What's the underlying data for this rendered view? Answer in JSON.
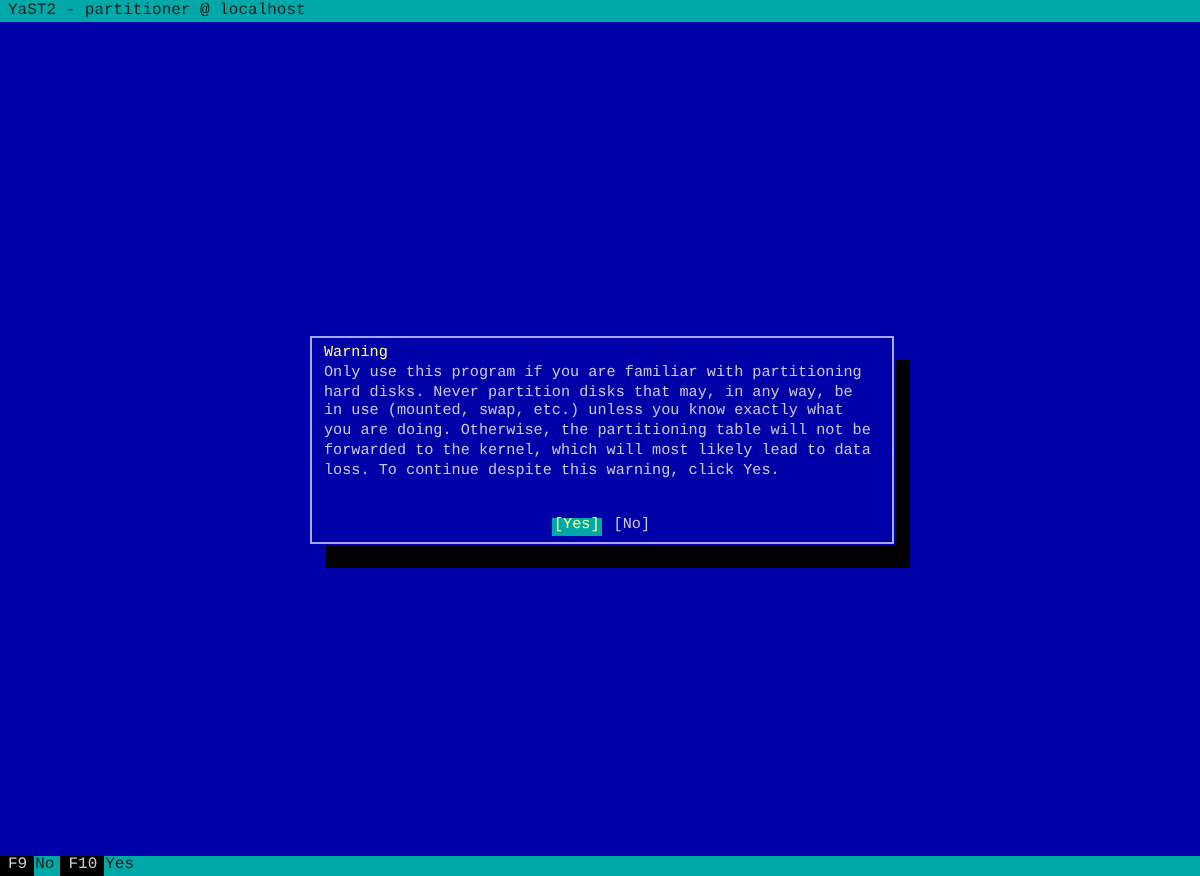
{
  "window": {
    "title": "YaST2 - partitioner @ localhost"
  },
  "dialog": {
    "title": "Warning",
    "message": "Only use this program if you are familiar with partitioning\nhard disks. Never partition disks that may, in any way, be\nin use (mounted, swap, etc.) unless you know exactly what\nyou are doing. Otherwise, the partitioning table will not be\nforwarded to the kernel, which will most likely lead to data\nloss. To continue despite this warning, click Yes.",
    "buttons": [
      {
        "label": "[Yes]",
        "selected": true
      },
      {
        "label": "[No]",
        "selected": false
      }
    ]
  },
  "function_keys": [
    {
      "key": "F9",
      "label": "No"
    },
    {
      "key": "F10",
      "label": "Yes"
    }
  ]
}
